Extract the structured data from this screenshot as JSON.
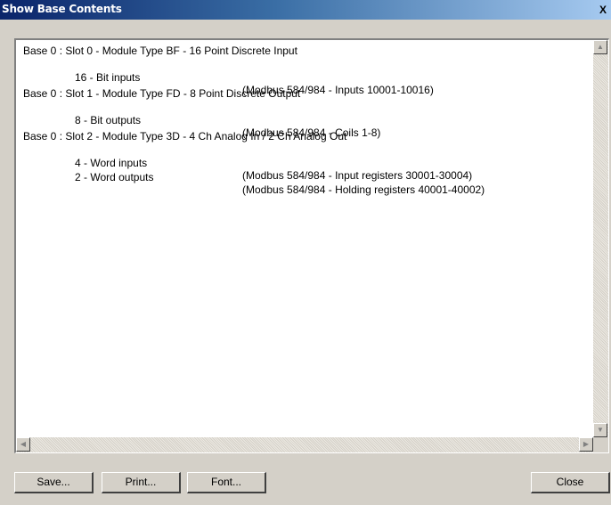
{
  "window": {
    "title": "Show Base Contents",
    "close_glyph": "X"
  },
  "lines": [
    "Base 0 : Slot 0 - Module Type BF - 16 Point Discrete Input",
    {
      "left": "16 - Bit inputs",
      "right": "(Modbus 584/984 - Inputs 10001-10016)"
    },
    "Base 0 : Slot 1 - Module Type FD - 8 Point Discrete Output",
    {
      "left": "8 - Bit outputs",
      "right": "(Modbus 584/984 - Coils 1-8)"
    },
    "Base 0 : Slot 2 - Module Type 3D - 4 Ch Analog In / 2 Ch Analog Out",
    {
      "left": "4 - Word inputs",
      "right": "(Modbus 584/984 - Input registers 30001-30004)"
    },
    {
      "left": "2 - Word outputs",
      "right": "(Modbus 584/984 - Holding registers 40001-40002)"
    }
  ],
  "buttons": {
    "save": "Save...",
    "print": "Print...",
    "font": "Font...",
    "close": "Close"
  },
  "scroll_glyphs": {
    "up": "▲",
    "down": "▼",
    "left": "◀",
    "right": "▶"
  }
}
